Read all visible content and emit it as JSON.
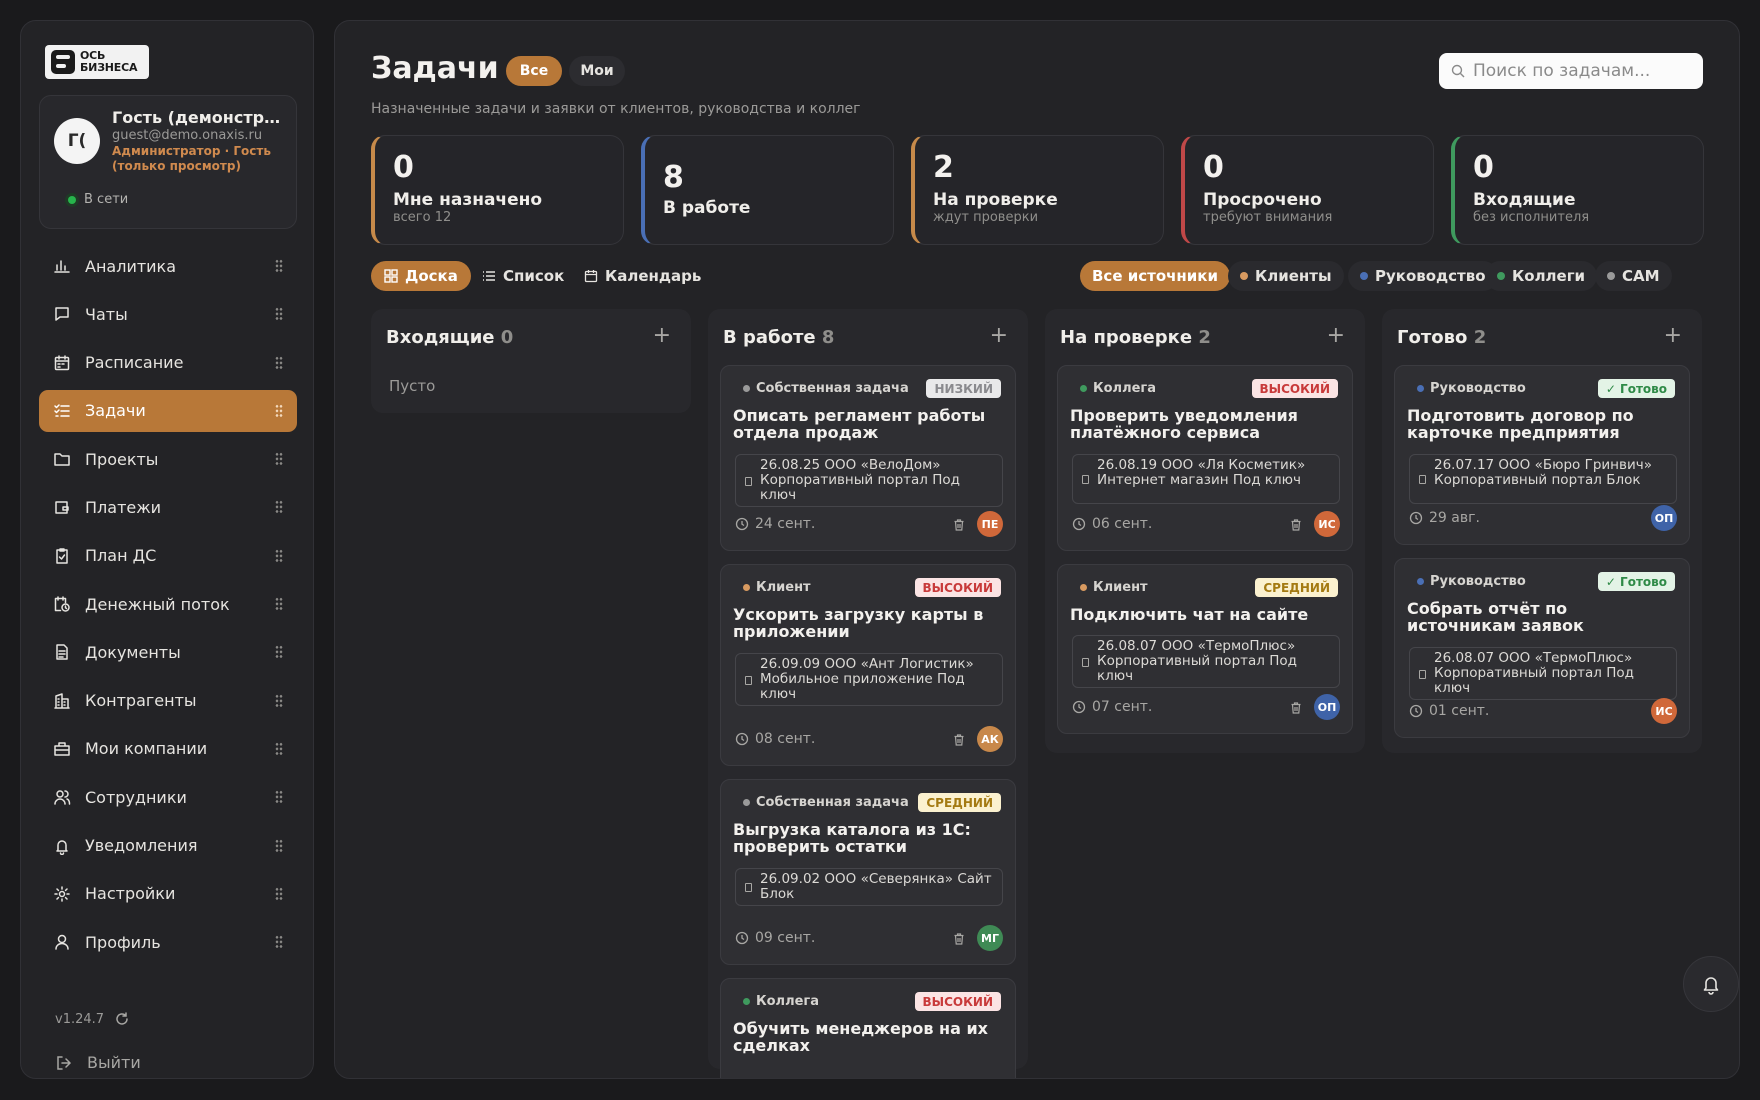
{
  "app": {
    "logo_line1": "ОСЬ",
    "logo_line2": "БИЗНЕСА"
  },
  "user": {
    "initials": "Г(",
    "name": "Гость (демонстрация)",
    "email": "guest@demo.onaxis.ru",
    "role": "Администратор · Гость (только просмотр)",
    "status": "В сети"
  },
  "nav": [
    {
      "label": "Аналитика",
      "icon": "chart-icon"
    },
    {
      "label": "Чаты",
      "icon": "chat-icon"
    },
    {
      "label": "Расписание",
      "icon": "calendar-icon"
    },
    {
      "label": "Задачи",
      "icon": "tasks-icon",
      "active": true
    },
    {
      "label": "Проекты",
      "icon": "folder-icon"
    },
    {
      "label": "Платежи",
      "icon": "wallet-icon"
    },
    {
      "label": "План ДС",
      "icon": "clipboard-icon"
    },
    {
      "label": "Денежный поток",
      "icon": "calendar-clock-icon"
    },
    {
      "label": "Документы",
      "icon": "document-icon"
    },
    {
      "label": "Контрагенты",
      "icon": "building-icon"
    },
    {
      "label": "Мои компании",
      "icon": "briefcase-icon"
    },
    {
      "label": "Сотрудники",
      "icon": "users-icon"
    },
    {
      "label": "Уведомления",
      "icon": "bell-icon"
    },
    {
      "label": "Настройки",
      "icon": "gear-icon"
    },
    {
      "label": "Профиль",
      "icon": "user-icon"
    }
  ],
  "version": "v1.24.7",
  "logout": "Выйти",
  "header": {
    "title": "Задачи",
    "filter_all": "Все",
    "filter_mine": "Мои",
    "subtitle": "Назначенные задачи и заявки от клиентов, руководства и коллег",
    "search_placeholder": "Поиск по задачам..."
  },
  "stats": [
    {
      "value": "0",
      "label": "Мне назначено",
      "sub": "всего 12",
      "color": "#c68a4a"
    },
    {
      "value": "8",
      "label": "В работе",
      "sub": "",
      "color": "#4a6fb5"
    },
    {
      "value": "2",
      "label": "На проверке",
      "sub": "ждут проверки",
      "color": "#c68a4a"
    },
    {
      "value": "0",
      "label": "Просрочено",
      "sub": "требуют внимания",
      "color": "#c04848"
    },
    {
      "value": "0",
      "label": "Входящие",
      "sub": "без исполнителя",
      "color": "#3f9a5e"
    }
  ],
  "views": {
    "board": "Доска",
    "list": "Список",
    "calendar": "Календарь"
  },
  "sources": [
    {
      "label": "Все источники",
      "active": true
    },
    {
      "label": "Клиенты",
      "color": "#d89a60"
    },
    {
      "label": "Руководство",
      "color": "#4a6fb5"
    },
    {
      "label": "Коллеги",
      "color": "#3f9a5e"
    },
    {
      "label": "САМ",
      "color": "#9a9a9a"
    }
  ],
  "columns": [
    {
      "title": "Входящие",
      "count": "0",
      "empty": "Пусто",
      "cards": []
    },
    {
      "title": "В работе",
      "count": "8",
      "cards": [
        {
          "source": "Собственная задача",
          "src_color": "#9a9a9a",
          "badge": "НИЗКИЙ",
          "badge_type": "low",
          "title": "Описать регламент работы отдела продаж",
          "project": "26.08.25 ООО «ВелоДом» Корпоративный портал Под ключ",
          "due": "24 сент.",
          "avatar": "ПЕ",
          "avatar_color": "#d0683a"
        },
        {
          "source": "Клиент",
          "src_color": "#d89a60",
          "badge": "ВЫСОКИЙ",
          "badge_type": "high",
          "title": "Ускорить загрузку карты в приложении",
          "project": "26.09.09 ООО «Ант Логистик» Мобильное приложение Под ключ",
          "due": "08 сент.",
          "avatar": "АК",
          "avatar_color": "#c8884a"
        },
        {
          "source": "Собственная задача",
          "src_color": "#9a9a9a",
          "badge": "СРЕДНИЙ",
          "badge_type": "mid",
          "title": "Выгрузка каталога из 1С: проверить остатки",
          "project": "26.09.02 ООО «Северянка» Сайт Блок",
          "due": "09 сент.",
          "avatar": "МГ",
          "avatar_color": "#3f8a55"
        },
        {
          "source": "Коллега",
          "src_color": "#3f9a5e",
          "badge": "ВЫСОКИЙ",
          "badge_type": "high",
          "title": "Обучить менеджеров на их сделках",
          "project": "",
          "due": "",
          "avatar": "",
          "avatar_color": ""
        }
      ]
    },
    {
      "title": "На проверке",
      "count": "2",
      "cards": [
        {
          "source": "Коллега",
          "src_color": "#3f9a5e",
          "badge": "ВЫСОКИЙ",
          "badge_type": "high",
          "title": "Проверить уведомления платёжного сервиса",
          "project": "26.08.19 ООО «Ля Косметик» Интернет магазин Под ключ",
          "due": "06 сент.",
          "avatar": "ИС",
          "avatar_color": "#d0683a"
        },
        {
          "source": "Клиент",
          "src_color": "#d89a60",
          "badge": "СРЕДНИЙ",
          "badge_type": "mid",
          "title": "Подключить чат на сайте",
          "project": "26.08.07 ООО «ТермоПлюс» Корпоративный портал Под ключ",
          "due": "07 сент.",
          "avatar": "ОП",
          "avatar_color": "#3f63a8"
        }
      ]
    },
    {
      "title": "Готово",
      "count": "2",
      "cards": [
        {
          "source": "Руководство",
          "src_color": "#4a6fb5",
          "badge": "✓ Готово",
          "badge_type": "done",
          "title": "Подготовить договор по карточке предприятия",
          "project": "26.07.17 ООО «Бюро Гринвич» Корпоративный портал Блок",
          "due": "29 авг.",
          "avatar": "ОП",
          "avatar_color": "#3f63a8"
        },
        {
          "source": "Руководство",
          "src_color": "#4a6fb5",
          "badge": "✓ Готово",
          "badge_type": "done",
          "title": "Собрать отчёт по источникам заявок",
          "project": "26.08.07 ООО «ТермоПлюс» Корпоративный портал Под ключ",
          "due": "01 сент.",
          "avatar": "ИС",
          "avatar_color": "#d0683a"
        }
      ]
    }
  ]
}
